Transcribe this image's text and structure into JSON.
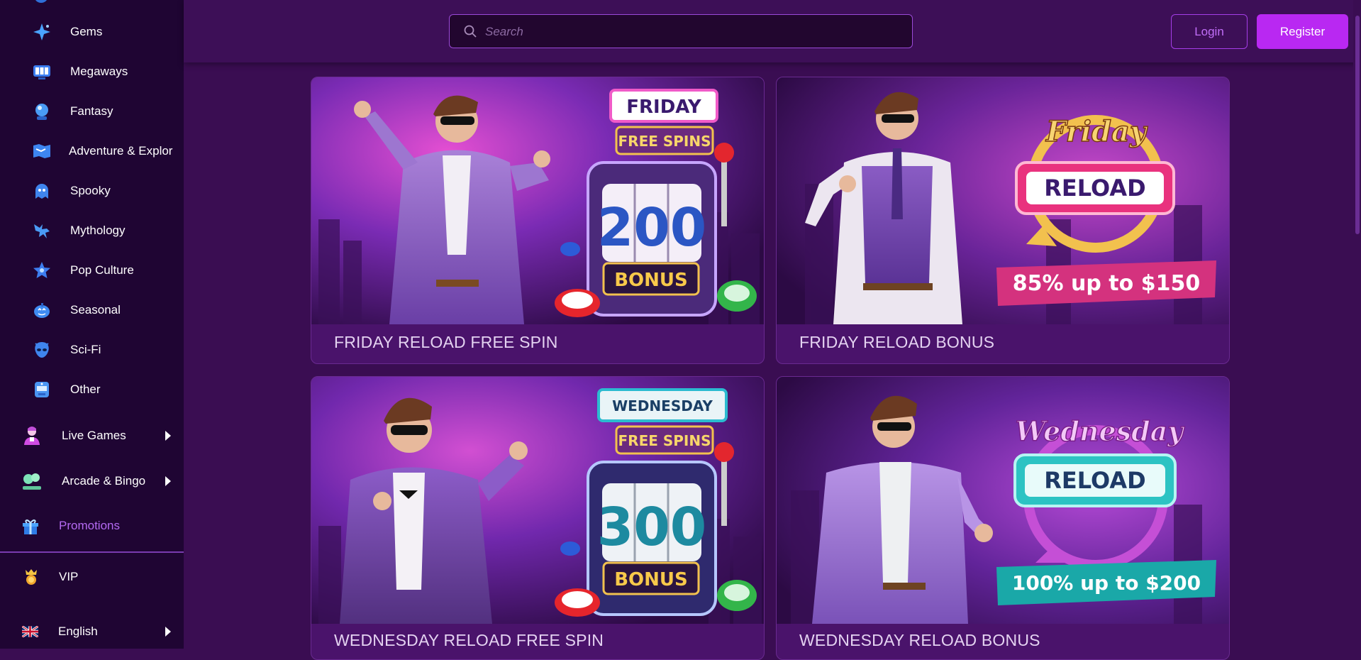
{
  "sidebar": {
    "items": [
      {
        "label": "Gems",
        "icon": "sparkle-icon"
      },
      {
        "label": "Megaways",
        "icon": "slot-777-icon"
      },
      {
        "label": "Fantasy",
        "icon": "crystal-ball-icon"
      },
      {
        "label": "Adventure & Explor",
        "icon": "map-icon"
      },
      {
        "label": "Spooky",
        "icon": "ghost-icon"
      },
      {
        "label": "Mythology",
        "icon": "pegasus-icon"
      },
      {
        "label": "Pop Culture",
        "icon": "star-icon"
      },
      {
        "label": "Seasonal",
        "icon": "pumpkin-icon"
      },
      {
        "label": "Sci-Fi",
        "icon": "alien-icon"
      },
      {
        "label": "Other",
        "icon": "slot-machine-icon"
      }
    ],
    "live_games": "Live Games",
    "arcade_bingo": "Arcade & Bingo",
    "promotions": "Promotions",
    "vip": "VIP",
    "language": "English"
  },
  "header": {
    "search_placeholder": "Search",
    "login": "Login",
    "register": "Register"
  },
  "promotions": [
    {
      "title": "FRIDAY RELOAD FREE SPIN",
      "banner": {
        "day": "FRIDAY",
        "subtitle": "FREE SPINS",
        "amount": "200",
        "footer": "BONUS"
      }
    },
    {
      "title": "FRIDAY RELOAD BONUS",
      "banner": {
        "day": "Friday",
        "label": "RELOAD",
        "offer": "85% up to $150"
      }
    },
    {
      "title": "WEDNESDAY RELOAD FREE SPIN",
      "banner": {
        "day": "WEDNESDAY",
        "subtitle": "FREE SPINS",
        "amount": "300",
        "footer": "BONUS"
      }
    },
    {
      "title": "WEDNESDAY RELOAD BONUS",
      "banner": {
        "day": "Wednesday",
        "label": "RELOAD",
        "offer": "100% up to $200"
      }
    }
  ],
  "colors": {
    "sidebar_bg": "#1f0533",
    "page_bg": "#3a0d52",
    "accent": "#b928f2",
    "promo_active": "#b46af2"
  }
}
